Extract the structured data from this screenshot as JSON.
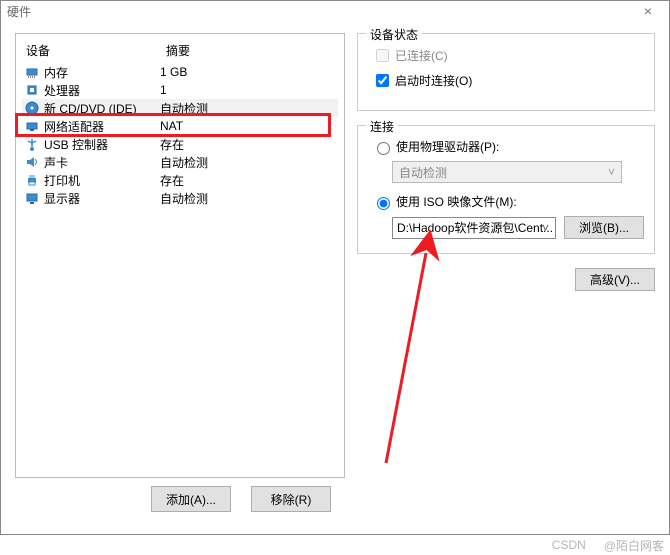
{
  "window": {
    "title": "硬件"
  },
  "list": {
    "header_device": "设备",
    "header_summary": "摘要",
    "rows": [
      {
        "name": "内存",
        "value": "1 GB",
        "icon": "memory"
      },
      {
        "name": "处理器",
        "value": "1",
        "icon": "cpu"
      },
      {
        "name": "新 CD/DVD (IDE)",
        "value": "自动检测",
        "icon": "cd",
        "selected": true
      },
      {
        "name": "网络适配器",
        "value": "NAT",
        "icon": "net"
      },
      {
        "name": "USB 控制器",
        "value": "存在",
        "icon": "usb"
      },
      {
        "name": "声卡",
        "value": "自动检测",
        "icon": "audio"
      },
      {
        "name": "打印机",
        "value": "存在",
        "icon": "printer"
      },
      {
        "name": "显示器",
        "value": "自动检测",
        "icon": "display"
      }
    ]
  },
  "buttons": {
    "add": "添加(A)...",
    "remove": "移除(R)",
    "browse": "浏览(B)...",
    "advanced": "高级(V)..."
  },
  "status_group": {
    "legend": "设备状态",
    "connected": "已连接(C)",
    "connect_at_poweron": "启动时连接(O)"
  },
  "conn_group": {
    "legend": "连接",
    "use_physical": "使用物理驱动器(P):",
    "physical_value": "自动检测",
    "use_iso": "使用 ISO 映像文件(M):",
    "iso_path": "D:\\Hadoop软件资源包\\Cent..."
  },
  "watermark": {
    "left": "CSDN",
    "right": "@陌白网客"
  }
}
